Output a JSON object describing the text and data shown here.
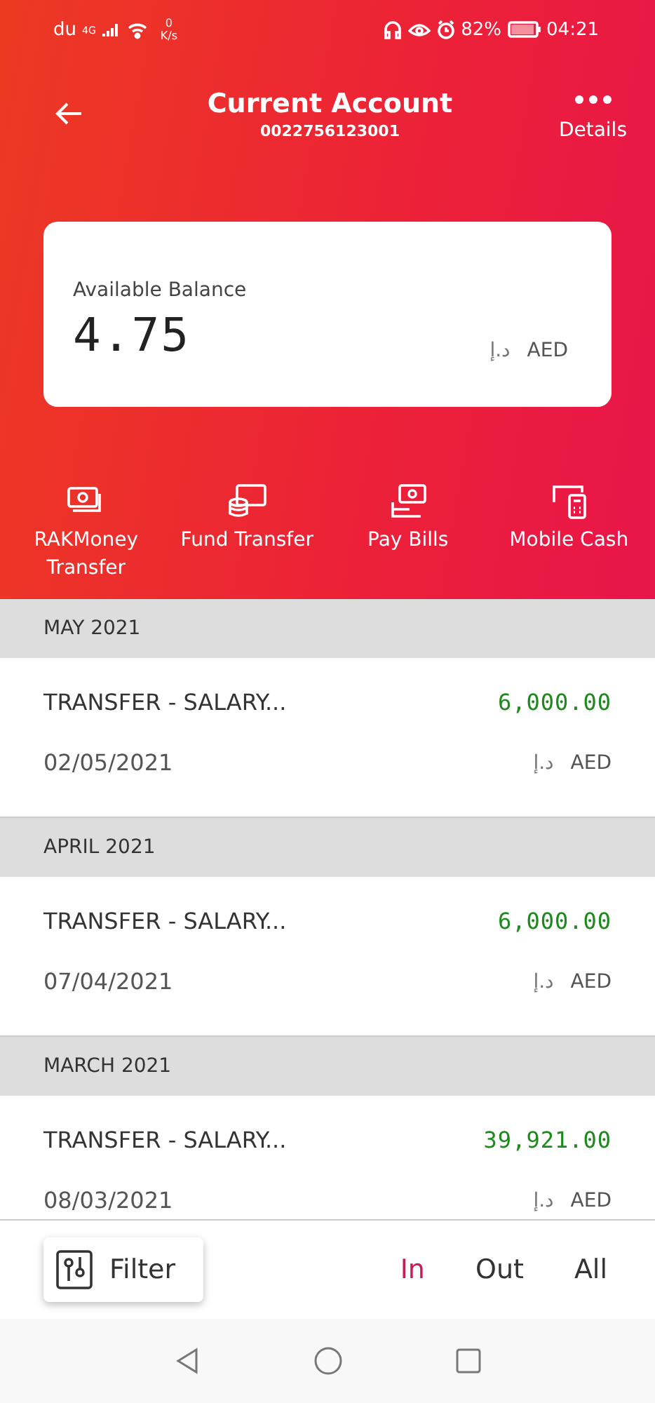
{
  "status_bar": {
    "carrier": "du",
    "network": "4G",
    "speed_value": "0",
    "speed_unit": "K/s",
    "battery": "82%",
    "time": "04:21"
  },
  "header": {
    "title": "Current Account",
    "account_number": "0022756123001",
    "details_label": "Details"
  },
  "balance": {
    "label": "Available Balance",
    "amount": "4.75",
    "currency_symbol": "د.إ",
    "currency": "AED"
  },
  "actions": [
    {
      "kind": "rakmoney",
      "label": "RAKMoney Transfer"
    },
    {
      "kind": "fund",
      "label": "Fund Transfer"
    },
    {
      "kind": "bills",
      "label": "Pay Bills"
    },
    {
      "kind": "mobile",
      "label": "Mobile Cash"
    }
  ],
  "months": [
    {
      "title": "MAY 2021",
      "transactions": [
        {
          "description": "TRANSFER - SALARY...",
          "amount": "6,000.00",
          "date": "02/05/2021",
          "currency_symbol": "د.إ",
          "currency": "AED"
        }
      ]
    },
    {
      "title": "APRIL 2021",
      "transactions": [
        {
          "description": "TRANSFER - SALARY...",
          "amount": "6,000.00",
          "date": "07/04/2021",
          "currency_symbol": "د.إ",
          "currency": "AED"
        }
      ]
    },
    {
      "title": "MARCH 2021",
      "transactions": [
        {
          "description": "TRANSFER - SALARY...",
          "amount": "39,921.00",
          "date": "08/03/2021",
          "currency_symbol": "د.إ",
          "currency": "AED"
        }
      ]
    }
  ],
  "filter": {
    "label": "Filter"
  },
  "tabs": [
    {
      "label": "In",
      "selected": true
    },
    {
      "label": "Out",
      "selected": false
    },
    {
      "label": "All",
      "selected": false
    }
  ]
}
